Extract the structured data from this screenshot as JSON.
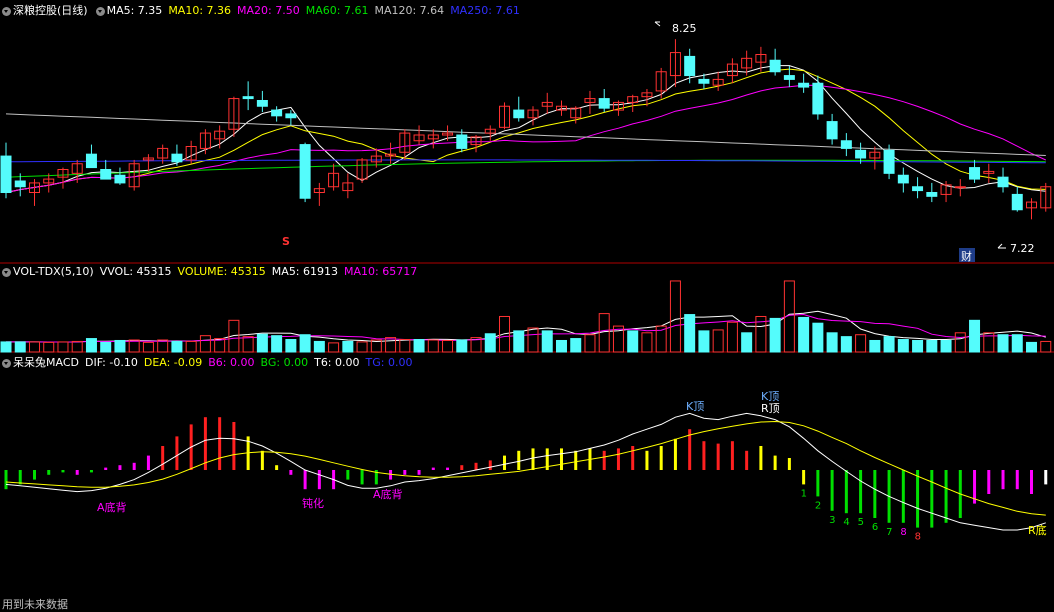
{
  "price_header": {
    "title": "深粮控股(日线)",
    "items": [
      {
        "label": "MA5: 7.35",
        "color": "#ffffff"
      },
      {
        "label": "MA10: 7.36",
        "color": "#ffff00"
      },
      {
        "label": "MA20: 7.50",
        "color": "#ff00ff"
      },
      {
        "label": "MA60: 7.61",
        "color": "#00e000"
      },
      {
        "label": "MA120: 7.64",
        "color": "#c0c0c0"
      },
      {
        "label": "MA250: 7.61",
        "color": "#3030ff"
      }
    ]
  },
  "volume_header": {
    "title": "VOL-TDX(5,10)",
    "items": [
      {
        "label": "VVOL: 45315",
        "color": "#ffffff"
      },
      {
        "label": "VOLUME: 45315",
        "color": "#ffff00"
      },
      {
        "label": "MA5: 61913",
        "color": "#ffffff"
      },
      {
        "label": "MA10: 65717",
        "color": "#ff00ff"
      }
    ]
  },
  "macd_header": {
    "title": "呆呆兔MACD",
    "items": [
      {
        "label": "DIF: -0.10",
        "color": "#ffffff"
      },
      {
        "label": "DEA: -0.09",
        "color": "#ffff00"
      },
      {
        "label": "B6: 0.00",
        "color": "#ff00ff"
      },
      {
        "label": "BG: 0.00",
        "color": "#00e000"
      },
      {
        "label": "T6: 0.00",
        "color": "#ffffff"
      },
      {
        "label": "TG: 0.00",
        "color": "#3030ff"
      }
    ]
  },
  "price_annotations": {
    "high_label": "8.25",
    "low_label": "7.22",
    "s_marker": "S",
    "cai_badge": "财"
  },
  "macd_annotations": {
    "k_top_1": "K顶",
    "k_top_2": "K顶",
    "r_top": "R顶",
    "a_bottom_div_1": "A底背",
    "dunhua": "钝化",
    "a_bottom_div_2": "A底背",
    "r_bottom": "R底",
    "counts": [
      "1",
      "2",
      "3",
      "4",
      "5",
      "6",
      "7",
      "8",
      "8"
    ]
  },
  "footer": "用到未来数据",
  "colors": {
    "up": "#ff3232",
    "down": "#54fcfc",
    "border": "#b00000",
    "macd_green": "#00e000",
    "macd_magenta": "#ff00ff",
    "macd_yellow": "#ffff00",
    "macd_red": "#ff2020"
  },
  "chart_data": {
    "type": "candlestick",
    "ohlc": [
      [
        7.64,
        7.71,
        7.42,
        7.45
      ],
      [
        7.51,
        7.55,
        7.43,
        7.48
      ],
      [
        7.45,
        7.52,
        7.38,
        7.5
      ],
      [
        7.5,
        7.55,
        7.45,
        7.52
      ],
      [
        7.53,
        7.58,
        7.47,
        7.57
      ],
      [
        7.55,
        7.62,
        7.5,
        7.6
      ],
      [
        7.65,
        7.7,
        7.58,
        7.58
      ],
      [
        7.57,
        7.62,
        7.52,
        7.52
      ],
      [
        7.54,
        7.58,
        7.49,
        7.5
      ],
      [
        7.48,
        7.62,
        7.46,
        7.6
      ],
      [
        7.62,
        7.65,
        7.56,
        7.63
      ],
      [
        7.63,
        7.7,
        7.6,
        7.68
      ],
      [
        7.65,
        7.7,
        7.59,
        7.61
      ],
      [
        7.62,
        7.72,
        7.6,
        7.69
      ],
      [
        7.68,
        7.78,
        7.65,
        7.76
      ],
      [
        7.73,
        7.8,
        7.68,
        7.77
      ],
      [
        7.78,
        7.95,
        7.74,
        7.94
      ],
      [
        7.95,
        8.03,
        7.88,
        7.94
      ],
      [
        7.93,
        7.98,
        7.87,
        7.9
      ],
      [
        7.88,
        7.9,
        7.82,
        7.85
      ],
      [
        7.86,
        7.88,
        7.8,
        7.84
      ],
      [
        7.7,
        7.71,
        7.4,
        7.42
      ],
      [
        7.45,
        7.5,
        7.38,
        7.47
      ],
      [
        7.48,
        7.6,
        7.46,
        7.55
      ],
      [
        7.46,
        7.55,
        7.42,
        7.5
      ],
      [
        7.52,
        7.63,
        7.5,
        7.62
      ],
      [
        7.61,
        7.68,
        7.58,
        7.64
      ],
      [
        7.64,
        7.71,
        7.6,
        7.65
      ],
      [
        7.66,
        7.78,
        7.62,
        7.76
      ],
      [
        7.72,
        7.8,
        7.7,
        7.75
      ],
      [
        7.73,
        7.78,
        7.68,
        7.75
      ],
      [
        7.75,
        7.8,
        7.72,
        7.76
      ],
      [
        7.75,
        7.78,
        7.66,
        7.68
      ],
      [
        7.7,
        7.75,
        7.66,
        7.74
      ],
      [
        7.76,
        7.8,
        7.72,
        7.78
      ],
      [
        7.79,
        7.92,
        7.78,
        7.9
      ],
      [
        7.88,
        7.95,
        7.82,
        7.84
      ],
      [
        7.84,
        7.9,
        7.8,
        7.88
      ],
      [
        7.9,
        7.97,
        7.86,
        7.92
      ],
      [
        7.88,
        7.93,
        7.85,
        7.9
      ],
      [
        7.84,
        7.9,
        7.81,
        7.89
      ],
      [
        7.92,
        7.98,
        7.86,
        7.94
      ],
      [
        7.94,
        7.99,
        7.87,
        7.89
      ],
      [
        7.88,
        7.93,
        7.85,
        7.92
      ],
      [
        7.92,
        7.96,
        7.87,
        7.95
      ],
      [
        7.95,
        7.99,
        7.9,
        7.97
      ],
      [
        7.98,
        8.1,
        7.94,
        8.08
      ],
      [
        8.06,
        8.25,
        8.0,
        8.18
      ],
      [
        8.16,
        8.2,
        8.02,
        8.06
      ],
      [
        8.04,
        8.07,
        7.99,
        8.02
      ],
      [
        8.01,
        8.08,
        7.98,
        8.04
      ],
      [
        8.06,
        8.15,
        8.02,
        8.12
      ],
      [
        8.1,
        8.19,
        8.06,
        8.15
      ],
      [
        8.13,
        8.21,
        8.08,
        8.17
      ],
      [
        8.14,
        8.2,
        8.06,
        8.08
      ],
      [
        8.06,
        8.11,
        8.0,
        8.04
      ],
      [
        8.02,
        8.07,
        7.97,
        8.0
      ],
      [
        8.02,
        8.06,
        7.83,
        7.86
      ],
      [
        7.82,
        7.86,
        7.7,
        7.73
      ],
      [
        7.72,
        7.76,
        7.64,
        7.68
      ],
      [
        7.67,
        7.71,
        7.6,
        7.63
      ],
      [
        7.63,
        7.69,
        7.57,
        7.66
      ],
      [
        7.67,
        7.7,
        7.52,
        7.55
      ],
      [
        7.54,
        7.58,
        7.45,
        7.5
      ],
      [
        7.48,
        7.53,
        7.42,
        7.46
      ],
      [
        7.45,
        7.5,
        7.4,
        7.43
      ],
      [
        7.44,
        7.51,
        7.4,
        7.49
      ],
      [
        7.48,
        7.52,
        7.43,
        7.48
      ],
      [
        7.58,
        7.62,
        7.5,
        7.52
      ],
      [
        7.55,
        7.6,
        7.5,
        7.56
      ],
      [
        7.53,
        7.58,
        7.45,
        7.48
      ],
      [
        7.44,
        7.48,
        7.35,
        7.36
      ],
      [
        7.37,
        7.42,
        7.31,
        7.4
      ],
      [
        7.37,
        7.5,
        7.35,
        7.48
      ]
    ],
    "volume": [
      [
        21000,
        0
      ],
      [
        21000,
        0
      ],
      [
        21000,
        1
      ],
      [
        20000,
        1
      ],
      [
        21000,
        1
      ],
      [
        22000,
        1
      ],
      [
        28000,
        0
      ],
      [
        20000,
        0
      ],
      [
        24000,
        0
      ],
      [
        25000,
        1
      ],
      [
        20000,
        1
      ],
      [
        25000,
        1
      ],
      [
        22000,
        0
      ],
      [
        22000,
        1
      ],
      [
        34000,
        1
      ],
      [
        28000,
        1
      ],
      [
        66000,
        1
      ],
      [
        32000,
        1
      ],
      [
        37000,
        0
      ],
      [
        34000,
        0
      ],
      [
        26000,
        0
      ],
      [
        36000,
        0
      ],
      [
        22000,
        0
      ],
      [
        19000,
        1
      ],
      [
        22000,
        0
      ],
      [
        21000,
        1
      ],
      [
        25000,
        1
      ],
      [
        30000,
        1
      ],
      [
        26000,
        1
      ],
      [
        26000,
        0
      ],
      [
        25000,
        1
      ],
      [
        24000,
        1
      ],
      [
        25000,
        0
      ],
      [
        30000,
        1
      ],
      [
        38000,
        0
      ],
      [
        74000,
        1
      ],
      [
        44000,
        0
      ],
      [
        50000,
        1
      ],
      [
        44000,
        0
      ],
      [
        24000,
        0
      ],
      [
        28000,
        0
      ],
      [
        36000,
        1
      ],
      [
        80000,
        1
      ],
      [
        54000,
        1
      ],
      [
        44000,
        0
      ],
      [
        40000,
        1
      ],
      [
        54000,
        1
      ],
      [
        148000,
        1
      ],
      [
        78000,
        0
      ],
      [
        44000,
        0
      ],
      [
        46000,
        1
      ],
      [
        62000,
        1
      ],
      [
        40000,
        0
      ],
      [
        74000,
        1
      ],
      [
        70000,
        0
      ],
      [
        148000,
        1
      ],
      [
        72000,
        0
      ],
      [
        60000,
        0
      ],
      [
        40000,
        0
      ],
      [
        32000,
        0
      ],
      [
        36000,
        1
      ],
      [
        24000,
        0
      ],
      [
        32000,
        0
      ],
      [
        26000,
        0
      ],
      [
        24000,
        0
      ],
      [
        24000,
        0
      ],
      [
        24000,
        0
      ],
      [
        40000,
        1
      ],
      [
        66000,
        0
      ],
      [
        40000,
        1
      ],
      [
        36000,
        0
      ],
      [
        36000,
        0
      ],
      [
        20000,
        0
      ],
      [
        22000,
        1
      ]
    ],
    "macd_hist": [
      -0.04,
      -0.03,
      -0.02,
      -0.01,
      -0.005,
      -0.01,
      -0.005,
      0.005,
      0.01,
      0.015,
      0.03,
      0.05,
      0.07,
      0.095,
      0.11,
      0.11,
      0.1,
      0.07,
      0.04,
      0.01,
      -0.01,
      -0.04,
      -0.04,
      -0.04,
      -0.02,
      -0.03,
      -0.03,
      -0.02,
      -0.01,
      -0.01,
      0.005,
      0.005,
      0.01,
      0.015,
      0.02,
      0.03,
      0.04,
      0.045,
      0.045,
      0.045,
      0.04,
      0.045,
      0.04,
      0.045,
      0.05,
      0.04,
      0.05,
      0.065,
      0.085,
      0.06,
      0.055,
      0.06,
      0.04,
      0.05,
      0.03,
      0.025,
      -0.03,
      -0.055,
      -0.085,
      -0.09,
      -0.09,
      -0.1,
      -0.11,
      -0.11,
      -0.12,
      -0.12,
      -0.11,
      -0.1,
      -0.07,
      -0.05,
      -0.04,
      -0.04,
      -0.05,
      -0.03
    ],
    "macd_hist_colors": "gggggmgmmmmrrrrrryyymmmmgggmmmmmrrryyyyyyyrrryyyrrrrryyyygggggggggggmmmmm",
    "dif": [
      -0.03,
      -0.033,
      -0.036,
      -0.039,
      -0.042,
      -0.045,
      -0.043,
      -0.038,
      -0.03,
      -0.02,
      -0.005,
      0.012,
      0.03,
      0.048,
      0.062,
      0.066,
      0.065,
      0.06,
      0.05,
      0.035,
      0.018,
      0.0,
      -0.01,
      -0.02,
      -0.032,
      -0.038,
      -0.038,
      -0.033,
      -0.025,
      -0.022,
      -0.018,
      -0.012,
      -0.006,
      0.0,
      0.006,
      0.012,
      0.018,
      0.025,
      0.03,
      0.034,
      0.038,
      0.045,
      0.052,
      0.062,
      0.075,
      0.085,
      0.095,
      0.11,
      0.118,
      0.108,
      0.105,
      0.112,
      0.118,
      0.113,
      0.105,
      0.09,
      0.066,
      0.04,
      0.018,
      -0.003,
      -0.023,
      -0.04,
      -0.055,
      -0.068,
      -0.08,
      -0.09,
      -0.1,
      -0.11,
      -0.115,
      -0.12,
      -0.125,
      -0.125,
      -0.12,
      -0.11
    ],
    "dea": [
      -0.025,
      -0.027,
      -0.029,
      -0.031,
      -0.033,
      -0.035,
      -0.036,
      -0.036,
      -0.034,
      -0.031,
      -0.026,
      -0.019,
      -0.009,
      0.003,
      0.015,
      0.025,
      0.032,
      0.036,
      0.038,
      0.037,
      0.034,
      0.029,
      0.022,
      0.015,
      0.008,
      0.001,
      -0.005,
      -0.009,
      -0.012,
      -0.014,
      -0.015,
      -0.015,
      -0.014,
      -0.012,
      -0.009,
      -0.006,
      -0.003,
      0.002,
      0.007,
      0.012,
      0.017,
      0.022,
      0.027,
      0.033,
      0.04,
      0.047,
      0.055,
      0.064,
      0.073,
      0.08,
      0.086,
      0.091,
      0.096,
      0.1,
      0.101,
      0.099,
      0.092,
      0.081,
      0.068,
      0.055,
      0.04,
      0.026,
      0.013,
      0.0,
      -0.013,
      -0.025,
      -0.038,
      -0.05,
      -0.06,
      -0.07,
      -0.078,
      -0.086,
      -0.091,
      -0.094
    ],
    "ma": {
      "ma5": {
        "color": "#ffffff"
      },
      "ma10": {
        "color": "#ffff00"
      },
      "ma20": {
        "color": "#ff00ff"
      },
      "ma60": {
        "color": "#00e000"
      },
      "ma120": {
        "color": "#c0c0c0"
      },
      "ma250": {
        "color": "#3030ff"
      }
    },
    "price_range": [
      7.15,
      8.35
    ]
  }
}
